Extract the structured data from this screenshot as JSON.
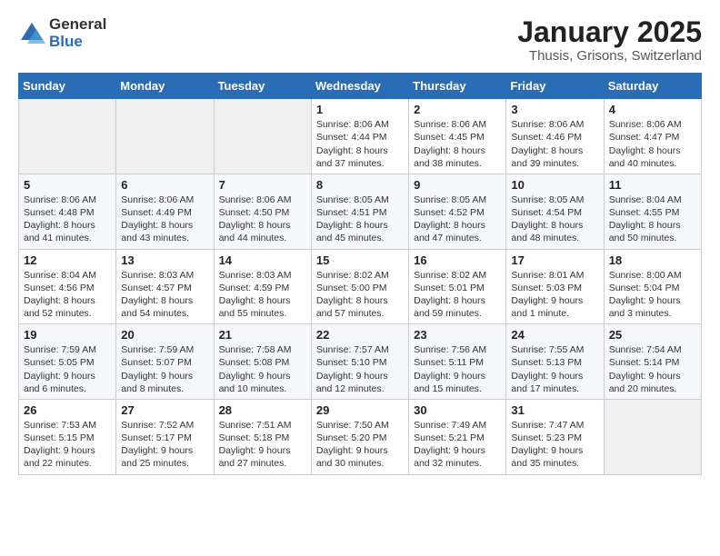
{
  "logo": {
    "general": "General",
    "blue": "Blue"
  },
  "header": {
    "month": "January 2025",
    "location": "Thusis, Grisons, Switzerland"
  },
  "weekdays": [
    "Sunday",
    "Monday",
    "Tuesday",
    "Wednesday",
    "Thursday",
    "Friday",
    "Saturday"
  ],
  "weeks": [
    [
      {
        "day": "",
        "info": ""
      },
      {
        "day": "",
        "info": ""
      },
      {
        "day": "",
        "info": ""
      },
      {
        "day": "1",
        "info": "Sunrise: 8:06 AM\nSunset: 4:44 PM\nDaylight: 8 hours\nand 37 minutes."
      },
      {
        "day": "2",
        "info": "Sunrise: 8:06 AM\nSunset: 4:45 PM\nDaylight: 8 hours\nand 38 minutes."
      },
      {
        "day": "3",
        "info": "Sunrise: 8:06 AM\nSunset: 4:46 PM\nDaylight: 8 hours\nand 39 minutes."
      },
      {
        "day": "4",
        "info": "Sunrise: 8:06 AM\nSunset: 4:47 PM\nDaylight: 8 hours\nand 40 minutes."
      }
    ],
    [
      {
        "day": "5",
        "info": "Sunrise: 8:06 AM\nSunset: 4:48 PM\nDaylight: 8 hours\nand 41 minutes."
      },
      {
        "day": "6",
        "info": "Sunrise: 8:06 AM\nSunset: 4:49 PM\nDaylight: 8 hours\nand 43 minutes."
      },
      {
        "day": "7",
        "info": "Sunrise: 8:06 AM\nSunset: 4:50 PM\nDaylight: 8 hours\nand 44 minutes."
      },
      {
        "day": "8",
        "info": "Sunrise: 8:05 AM\nSunset: 4:51 PM\nDaylight: 8 hours\nand 45 minutes."
      },
      {
        "day": "9",
        "info": "Sunrise: 8:05 AM\nSunset: 4:52 PM\nDaylight: 8 hours\nand 47 minutes."
      },
      {
        "day": "10",
        "info": "Sunrise: 8:05 AM\nSunset: 4:54 PM\nDaylight: 8 hours\nand 48 minutes."
      },
      {
        "day": "11",
        "info": "Sunrise: 8:04 AM\nSunset: 4:55 PM\nDaylight: 8 hours\nand 50 minutes."
      }
    ],
    [
      {
        "day": "12",
        "info": "Sunrise: 8:04 AM\nSunset: 4:56 PM\nDaylight: 8 hours\nand 52 minutes."
      },
      {
        "day": "13",
        "info": "Sunrise: 8:03 AM\nSunset: 4:57 PM\nDaylight: 8 hours\nand 54 minutes."
      },
      {
        "day": "14",
        "info": "Sunrise: 8:03 AM\nSunset: 4:59 PM\nDaylight: 8 hours\nand 55 minutes."
      },
      {
        "day": "15",
        "info": "Sunrise: 8:02 AM\nSunset: 5:00 PM\nDaylight: 8 hours\nand 57 minutes."
      },
      {
        "day": "16",
        "info": "Sunrise: 8:02 AM\nSunset: 5:01 PM\nDaylight: 8 hours\nand 59 minutes."
      },
      {
        "day": "17",
        "info": "Sunrise: 8:01 AM\nSunset: 5:03 PM\nDaylight: 9 hours\nand 1 minute."
      },
      {
        "day": "18",
        "info": "Sunrise: 8:00 AM\nSunset: 5:04 PM\nDaylight: 9 hours\nand 3 minutes."
      }
    ],
    [
      {
        "day": "19",
        "info": "Sunrise: 7:59 AM\nSunset: 5:05 PM\nDaylight: 9 hours\nand 6 minutes."
      },
      {
        "day": "20",
        "info": "Sunrise: 7:59 AM\nSunset: 5:07 PM\nDaylight: 9 hours\nand 8 minutes."
      },
      {
        "day": "21",
        "info": "Sunrise: 7:58 AM\nSunset: 5:08 PM\nDaylight: 9 hours\nand 10 minutes."
      },
      {
        "day": "22",
        "info": "Sunrise: 7:57 AM\nSunset: 5:10 PM\nDaylight: 9 hours\nand 12 minutes."
      },
      {
        "day": "23",
        "info": "Sunrise: 7:56 AM\nSunset: 5:11 PM\nDaylight: 9 hours\nand 15 minutes."
      },
      {
        "day": "24",
        "info": "Sunrise: 7:55 AM\nSunset: 5:13 PM\nDaylight: 9 hours\nand 17 minutes."
      },
      {
        "day": "25",
        "info": "Sunrise: 7:54 AM\nSunset: 5:14 PM\nDaylight: 9 hours\nand 20 minutes."
      }
    ],
    [
      {
        "day": "26",
        "info": "Sunrise: 7:53 AM\nSunset: 5:15 PM\nDaylight: 9 hours\nand 22 minutes."
      },
      {
        "day": "27",
        "info": "Sunrise: 7:52 AM\nSunset: 5:17 PM\nDaylight: 9 hours\nand 25 minutes."
      },
      {
        "day": "28",
        "info": "Sunrise: 7:51 AM\nSunset: 5:18 PM\nDaylight: 9 hours\nand 27 minutes."
      },
      {
        "day": "29",
        "info": "Sunrise: 7:50 AM\nSunset: 5:20 PM\nDaylight: 9 hours\nand 30 minutes."
      },
      {
        "day": "30",
        "info": "Sunrise: 7:49 AM\nSunset: 5:21 PM\nDaylight: 9 hours\nand 32 minutes."
      },
      {
        "day": "31",
        "info": "Sunrise: 7:47 AM\nSunset: 5:23 PM\nDaylight: 9 hours\nand 35 minutes."
      },
      {
        "day": "",
        "info": ""
      }
    ]
  ]
}
